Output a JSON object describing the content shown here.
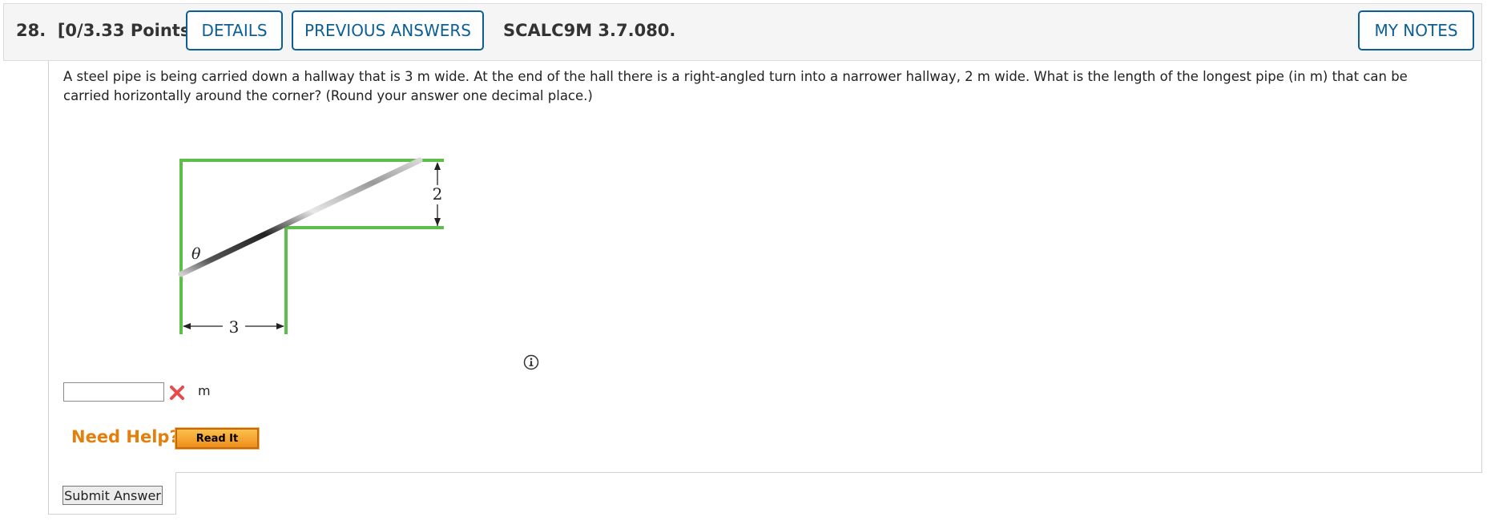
{
  "header": {
    "question_number": "28.",
    "points": "[0/3.33 Points]",
    "details_label": "DETAILS",
    "previous_answers_label": "PREVIOUS ANSWERS",
    "problem_code": "SCALC9M 3.7.080.",
    "my_notes_label": "MY NOTES"
  },
  "question": {
    "text": "A steel pipe is being carried down a hallway that is 3 m wide. At the end of the hall there is a right-angled turn into a narrower hallway, 2 m wide. What is the length of the longest pipe (in m) that can be carried horizontally around the corner? (Round your answer one decimal place.)"
  },
  "figure": {
    "width_label": "3",
    "height_label": "2",
    "angle_label": "θ",
    "wall_color": "#5cbf4a"
  },
  "answer": {
    "value": "",
    "unit": "m",
    "status": "incorrect",
    "status_icon": "x-icon"
  },
  "help": {
    "need_help_label": "Need Help?",
    "read_it_label": "Read It"
  },
  "submit_label": "Submit Answer"
}
